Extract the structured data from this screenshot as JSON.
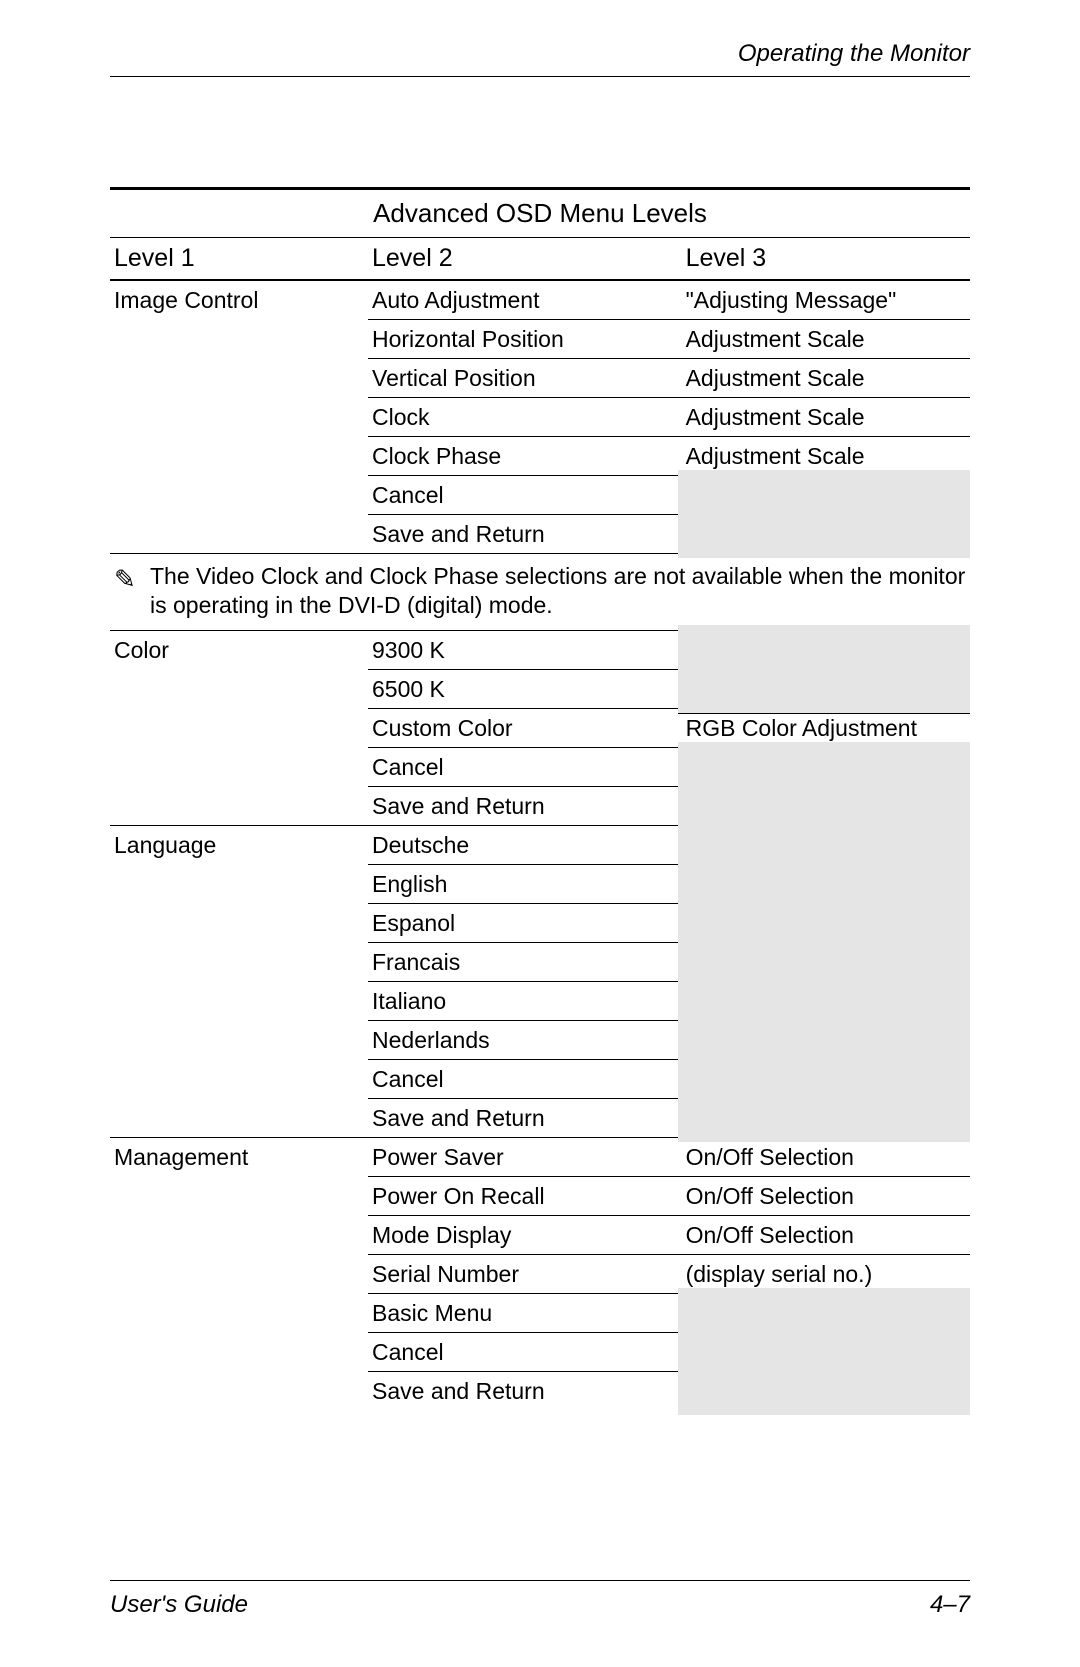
{
  "header": {
    "section": "Operating the Monitor"
  },
  "table": {
    "title": "Advanced OSD Menu Levels",
    "columns": {
      "c1": "Level 1",
      "c2": "Level 2",
      "c3": "Level 3"
    },
    "note": "The Video Clock and Clock Phase selections are not available when the monitor is operating in the DVI-D (digital) mode.",
    "groups": [
      {
        "level1": "Image Control",
        "rows": [
          {
            "l2": "Auto Adjustment",
            "l3": "\"Adjusting Message\"",
            "shade": false
          },
          {
            "l2": "Horizontal Position",
            "l3": "Adjustment Scale",
            "shade": false
          },
          {
            "l2": "Vertical Position",
            "l3": "Adjustment Scale",
            "shade": false
          },
          {
            "l2": "Clock",
            "l3": "Adjustment Scale",
            "shade": false
          },
          {
            "l2": "Clock Phase",
            "l3": "Adjustment Scale",
            "shade": false
          },
          {
            "l2": "Cancel",
            "l3": "",
            "shade": true
          },
          {
            "l2": "Save and Return",
            "l3": "",
            "shade": true
          }
        ]
      },
      {
        "level1": "Color",
        "rows": [
          {
            "l2": "9300 K",
            "l3": "",
            "shade": true
          },
          {
            "l2": "6500 K",
            "l3": "",
            "shade": true
          },
          {
            "l2": "Custom Color",
            "l3": "RGB Color Adjustment",
            "shade": false
          },
          {
            "l2": "Cancel",
            "l3": "",
            "shade": true
          },
          {
            "l2": "Save and Return",
            "l3": "",
            "shade": true
          }
        ]
      },
      {
        "level1": "Language",
        "rows": [
          {
            "l2": "Deutsche",
            "l3": "",
            "shade": true
          },
          {
            "l2": "English",
            "l3": "",
            "shade": true
          },
          {
            "l2": "Espanol",
            "l3": "",
            "shade": true
          },
          {
            "l2": "Francais",
            "l3": "",
            "shade": true
          },
          {
            "l2": "Italiano",
            "l3": "",
            "shade": true
          },
          {
            "l2": "Nederlands",
            "l3": "",
            "shade": true
          },
          {
            "l2": "Cancel",
            "l3": "",
            "shade": true
          },
          {
            "l2": "Save and Return",
            "l3": "",
            "shade": true
          }
        ]
      },
      {
        "level1": "Management",
        "rows": [
          {
            "l2": "Power Saver",
            "l3": "On/Off Selection",
            "shade": false
          },
          {
            "l2": "Power On Recall",
            "l3": "On/Off Selection",
            "shade": false
          },
          {
            "l2": "Mode Display",
            "l3": "On/Off Selection",
            "shade": false
          },
          {
            "l2": "Serial Number",
            "l3": "(display serial no.)",
            "shade": false
          },
          {
            "l2": "Basic Menu",
            "l3": "",
            "shade": true
          },
          {
            "l2": "Cancel",
            "l3": "",
            "shade": true
          },
          {
            "l2": "Save and Return",
            "l3": "",
            "shade": true
          }
        ]
      }
    ]
  },
  "footer": {
    "left": "User's Guide",
    "right": "4–7"
  }
}
